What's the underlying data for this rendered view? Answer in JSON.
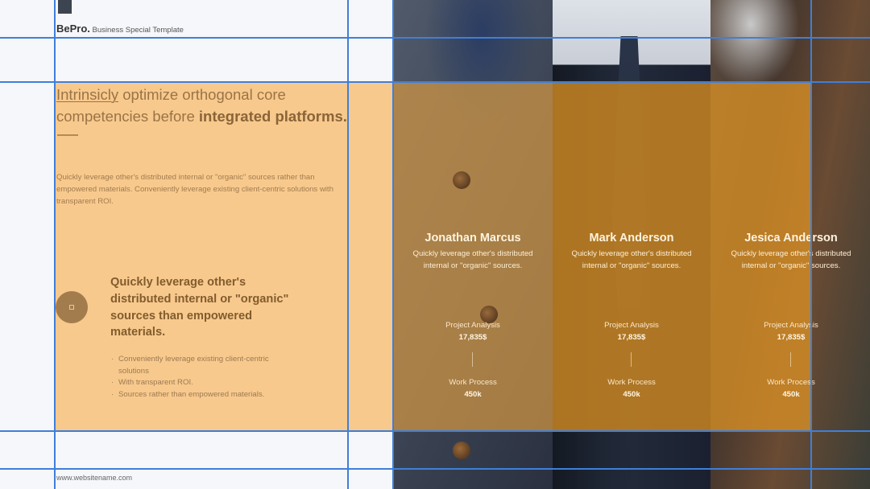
{
  "brand": {
    "name": "BePro.",
    "tagline": "Business Special Template"
  },
  "headline": {
    "underlined": "Intrinsicly",
    "middle": " optimize orthogonal core competencies before ",
    "bold": "integrated platforms."
  },
  "intro": "Quickly leverage other's distributed internal or \"organic\" sources rather than empowered materials. Conveniently leverage existing client-centric solutions with transparent ROI.",
  "feature": {
    "title": "Quickly leverage other's distributed internal or \"organic\" sources than empowered materials.",
    "bullets": [
      "Conveniently leverage existing client-centric solutions",
      "With transparent ROI.",
      "Sources rather than empowered materials."
    ]
  },
  "members": [
    {
      "name": "Jonathan Marcus",
      "description": "Quickly leverage other's distributed internal or \"organic\" sources.",
      "stat1_label": "Project Analysis",
      "stat1_value": "17,835$",
      "stat2_label": "Work Process",
      "stat2_value": "450k"
    },
    {
      "name": "Mark Anderson",
      "description": "Quickly leverage other's distributed internal or \"organic\" sources.",
      "stat1_label": "Project Analysis",
      "stat1_value": "17,835$",
      "stat2_label": "Work Process",
      "stat2_value": "450k"
    },
    {
      "name": "Jesica Anderson",
      "description": "Quickly leverage other's distributed internal or \"organic\" sources.",
      "stat1_label": "Project Analysis",
      "stat1_value": "17,835$",
      "stat2_label": "Work Process",
      "stat2_value": "450k"
    }
  ],
  "footer": {
    "website": "www.websitename.com"
  },
  "colors": {
    "accent": "#f8c98d",
    "overlay": "#c98a2e",
    "guide": "#3f7fd9",
    "dark": "#3d4451"
  },
  "icons": [
    "brand-square-icon",
    "circle-square-icon"
  ]
}
